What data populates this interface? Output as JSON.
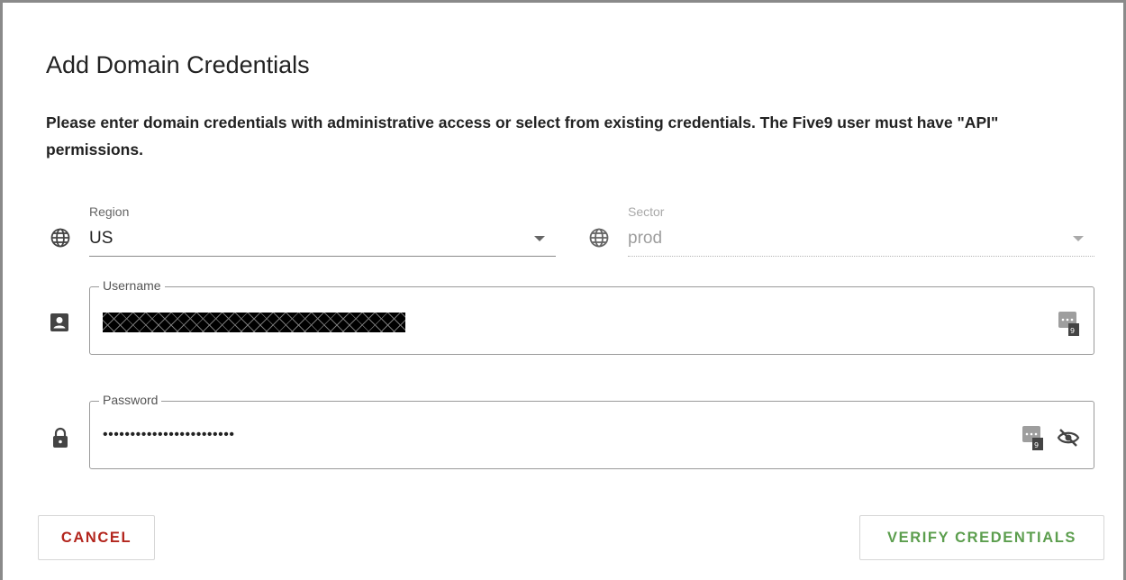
{
  "dialog": {
    "title": "Add Domain Credentials",
    "description": "Please enter domain credentials with administrative access or select from existing credentials. The Five9 user must have \"API\" permissions."
  },
  "region": {
    "label": "Region",
    "value": "US",
    "icon": "globe-icon"
  },
  "sector": {
    "label": "Sector",
    "value": "prod",
    "icon": "globe-icon",
    "disabled": true
  },
  "username": {
    "label": "Username",
    "icon": "account-box-icon",
    "value_redacted": true,
    "autofill_icon": "password-manager-icon"
  },
  "password": {
    "label": "Password",
    "value_masked": "••••••••••••••••••••••••",
    "icon": "lock-icon",
    "autofill_icon": "password-manager-icon",
    "visibility_icon": "visibility-off-icon"
  },
  "actions": {
    "cancel_label": "CANCEL",
    "verify_label": "VERIFY CREDENTIALS"
  },
  "colors": {
    "cancel": "#b3261e",
    "verify": "#5c9e4e"
  }
}
